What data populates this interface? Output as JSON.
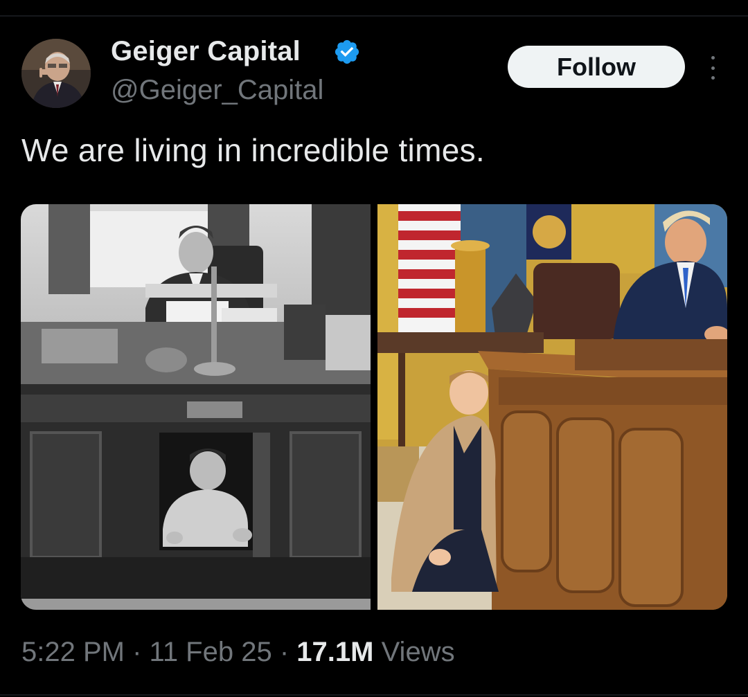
{
  "author": {
    "display_name": "Geiger Capital",
    "handle": "@Geiger_Capital",
    "verified": true,
    "avatar_icon": "user-avatar"
  },
  "actions": {
    "follow_label": "Follow",
    "more_icon": "more-vertical-icon"
  },
  "tweet": {
    "text": "We are living in incredible times."
  },
  "media": {
    "count": 2,
    "images": [
      "photo-black-and-white-desk",
      "photo-color-desk"
    ]
  },
  "meta": {
    "time": "5:22 PM",
    "separator": "·",
    "date": "11 Feb 25",
    "views_count": "17.1M",
    "views_label": "Views"
  },
  "colors": {
    "background": "#000000",
    "primary_text": "#e7e9ea",
    "secondary_text": "#71767b",
    "verified": "#1d9bf0",
    "follow_bg": "#eff3f4"
  }
}
